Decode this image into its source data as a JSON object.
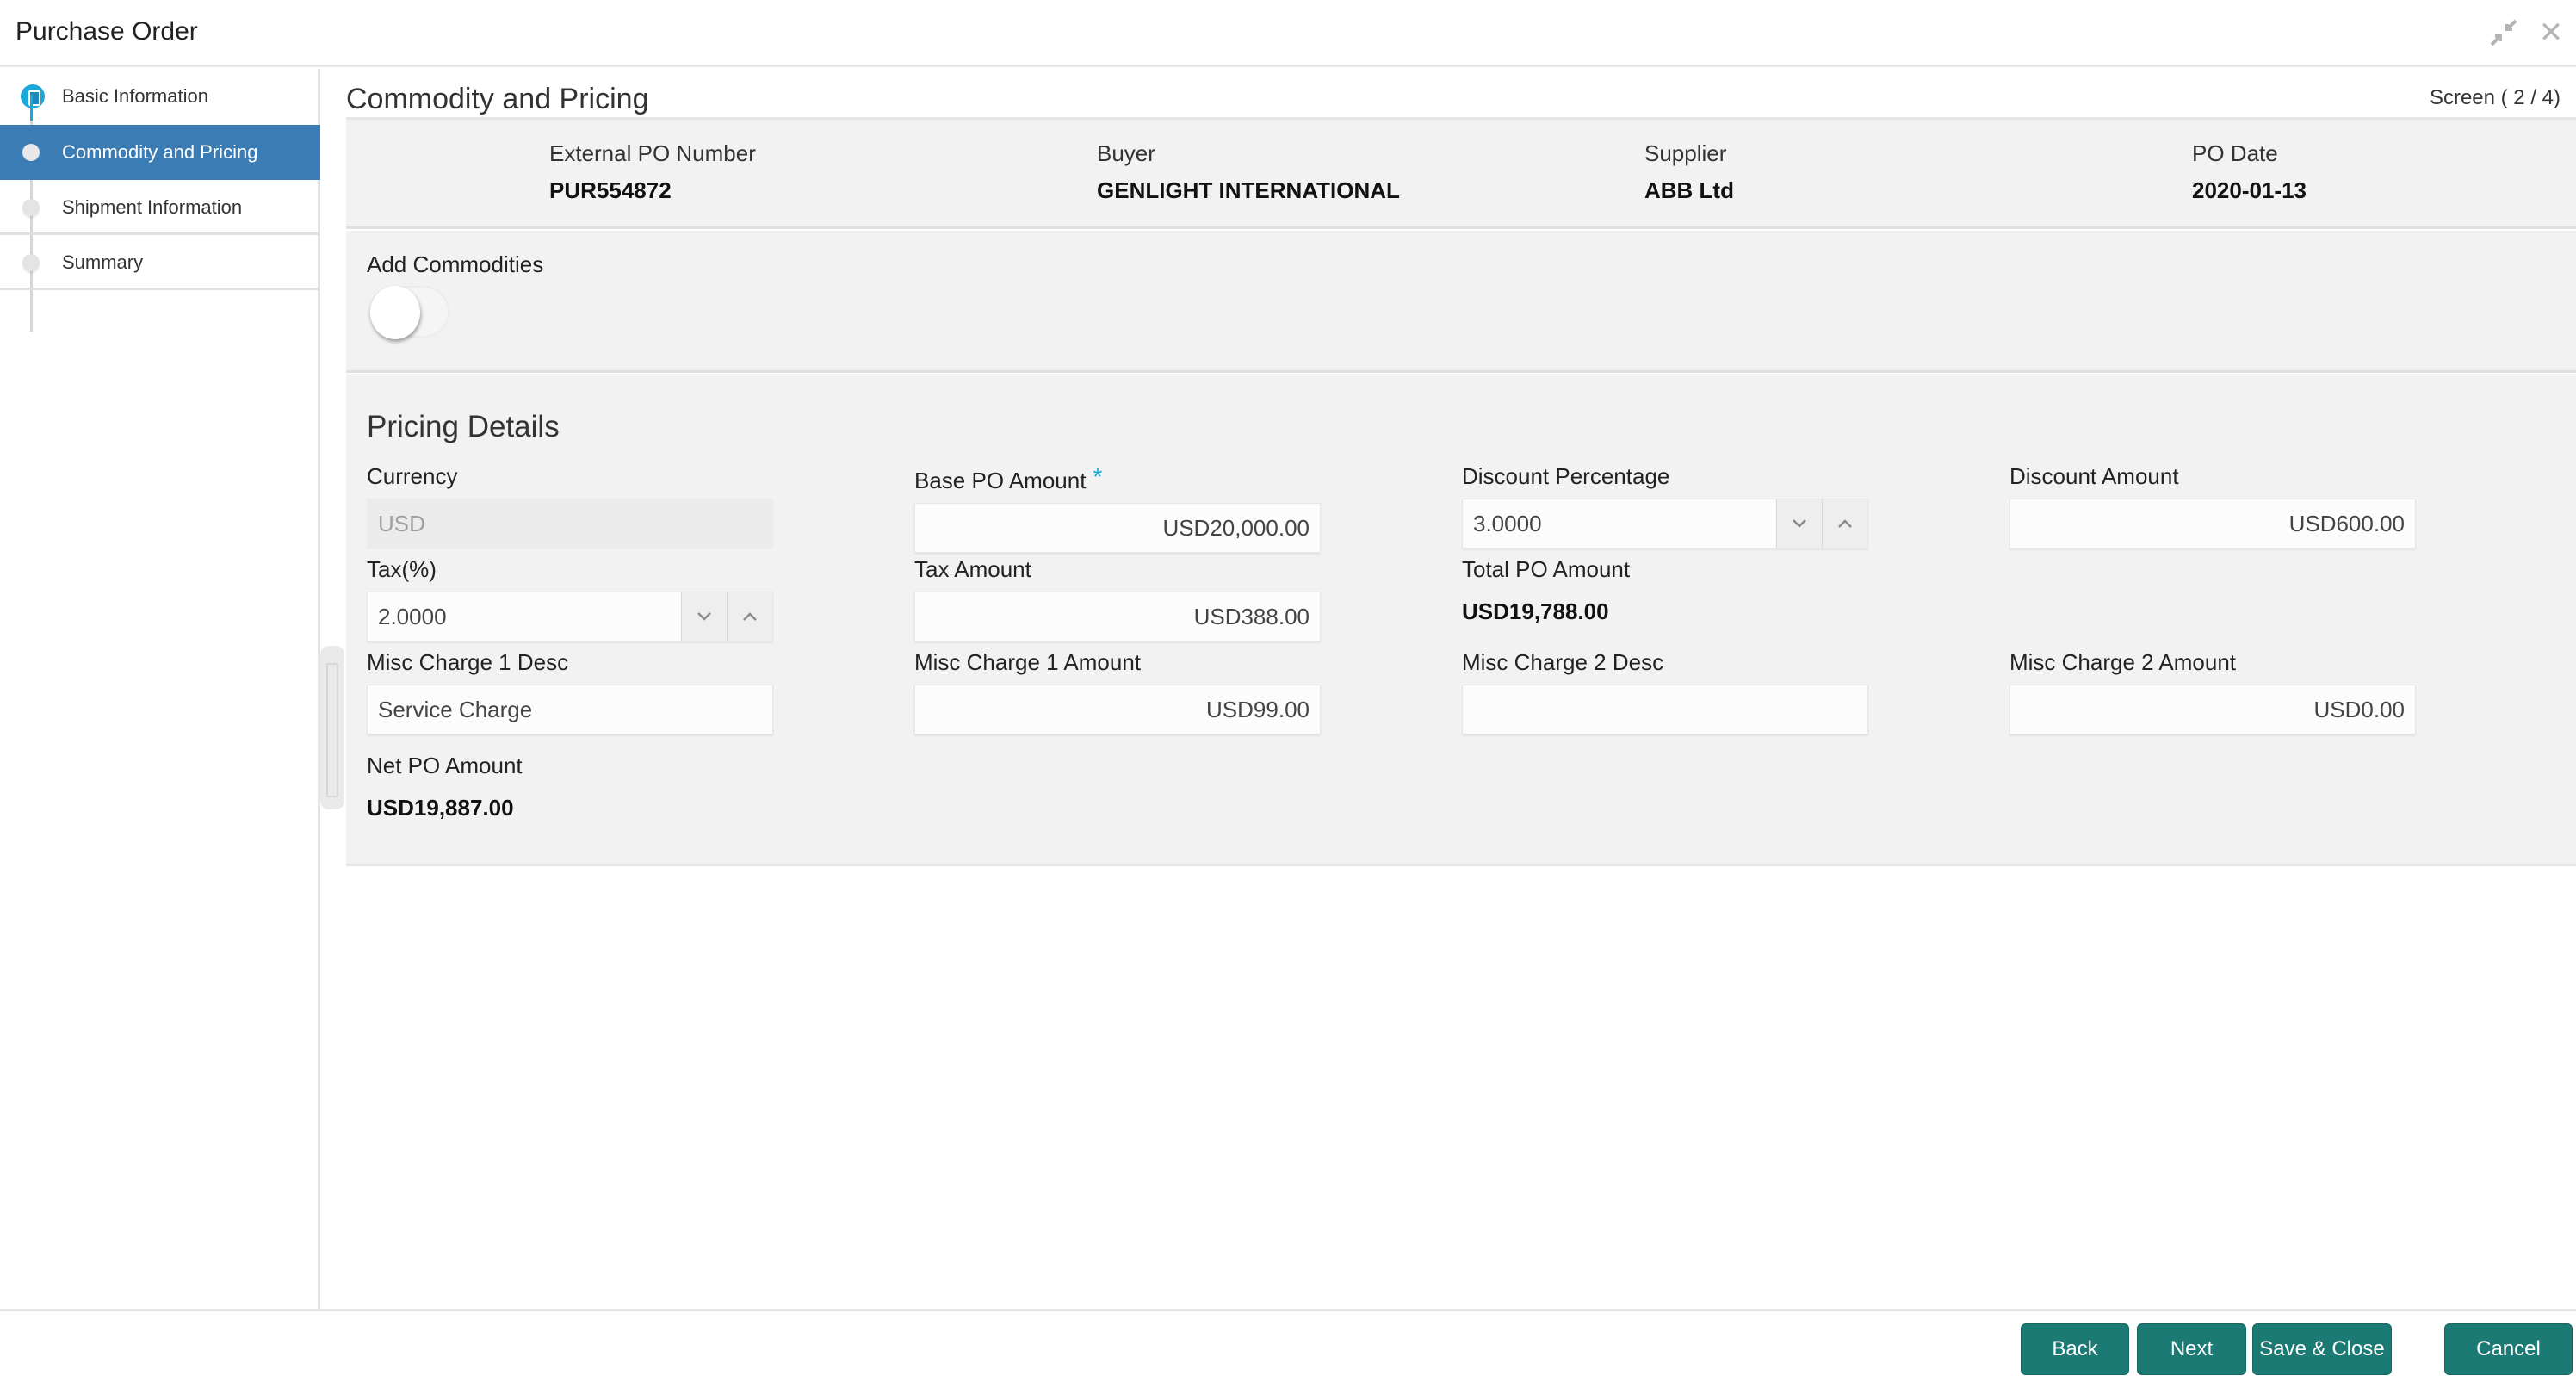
{
  "window": {
    "title": "Purchase Order",
    "icons": {
      "minimize": "↘",
      "close": "✕"
    }
  },
  "sidebar": {
    "items": [
      {
        "label": "Basic Information",
        "state": "completed"
      },
      {
        "label": "Commodity and Pricing",
        "state": "active"
      },
      {
        "label": "Shipment Information",
        "state": "pending"
      },
      {
        "label": "Summary",
        "state": "pending"
      }
    ]
  },
  "main": {
    "title": "Commodity and Pricing",
    "screen_counter": "Screen ( 2 / 4)",
    "summary": [
      {
        "label": "External PO Number",
        "value": "PUR554872"
      },
      {
        "label": "Buyer",
        "value": "GENLIGHT INTERNATIONAL"
      },
      {
        "label": "Supplier",
        "value": "ABB Ltd"
      },
      {
        "label": "PO Date",
        "value": "2020-01-13"
      }
    ],
    "add_commodities": {
      "label": "Add Commodities",
      "enabled": false
    },
    "pricing": {
      "title": "Pricing Details",
      "currency": {
        "label": "Currency",
        "value": "USD"
      },
      "base_po_amount": {
        "label": "Base PO Amount",
        "required_mark": "*",
        "value": "USD20,000.00"
      },
      "discount_percentage": {
        "label": "Discount Percentage",
        "value": "3.0000"
      },
      "discount_amount": {
        "label": "Discount Amount",
        "value": "USD600.00"
      },
      "tax_percent": {
        "label": "Tax(%)",
        "value": "2.0000"
      },
      "tax_amount": {
        "label": "Tax Amount",
        "value": "USD388.00"
      },
      "total_po_amount": {
        "label": "Total PO Amount",
        "value": "USD19,788.00"
      },
      "misc_charge_1_desc": {
        "label": "Misc Charge 1 Desc",
        "value": "Service Charge"
      },
      "misc_charge_1_amount": {
        "label": "Misc Charge 1 Amount",
        "value": "USD99.00"
      },
      "misc_charge_2_desc": {
        "label": "Misc Charge 2 Desc",
        "value": ""
      },
      "misc_charge_2_amount": {
        "label": "Misc Charge 2 Amount",
        "value": "USD0.00"
      },
      "net_po_amount": {
        "label": "Net PO Amount",
        "value": "USD19,887.00"
      },
      "spinner_icons": {
        "down": "⌄",
        "up": "⌃"
      }
    }
  },
  "footer": {
    "back": "Back",
    "next": "Next",
    "save_close": "Save & Close",
    "cancel": "Cancel"
  },
  "colors": {
    "active_nav": "#3a7cb3",
    "step_complete": "#1ba8d9",
    "button_primary": "#1b7a74",
    "panel_bg": "#f2f2f2"
  }
}
